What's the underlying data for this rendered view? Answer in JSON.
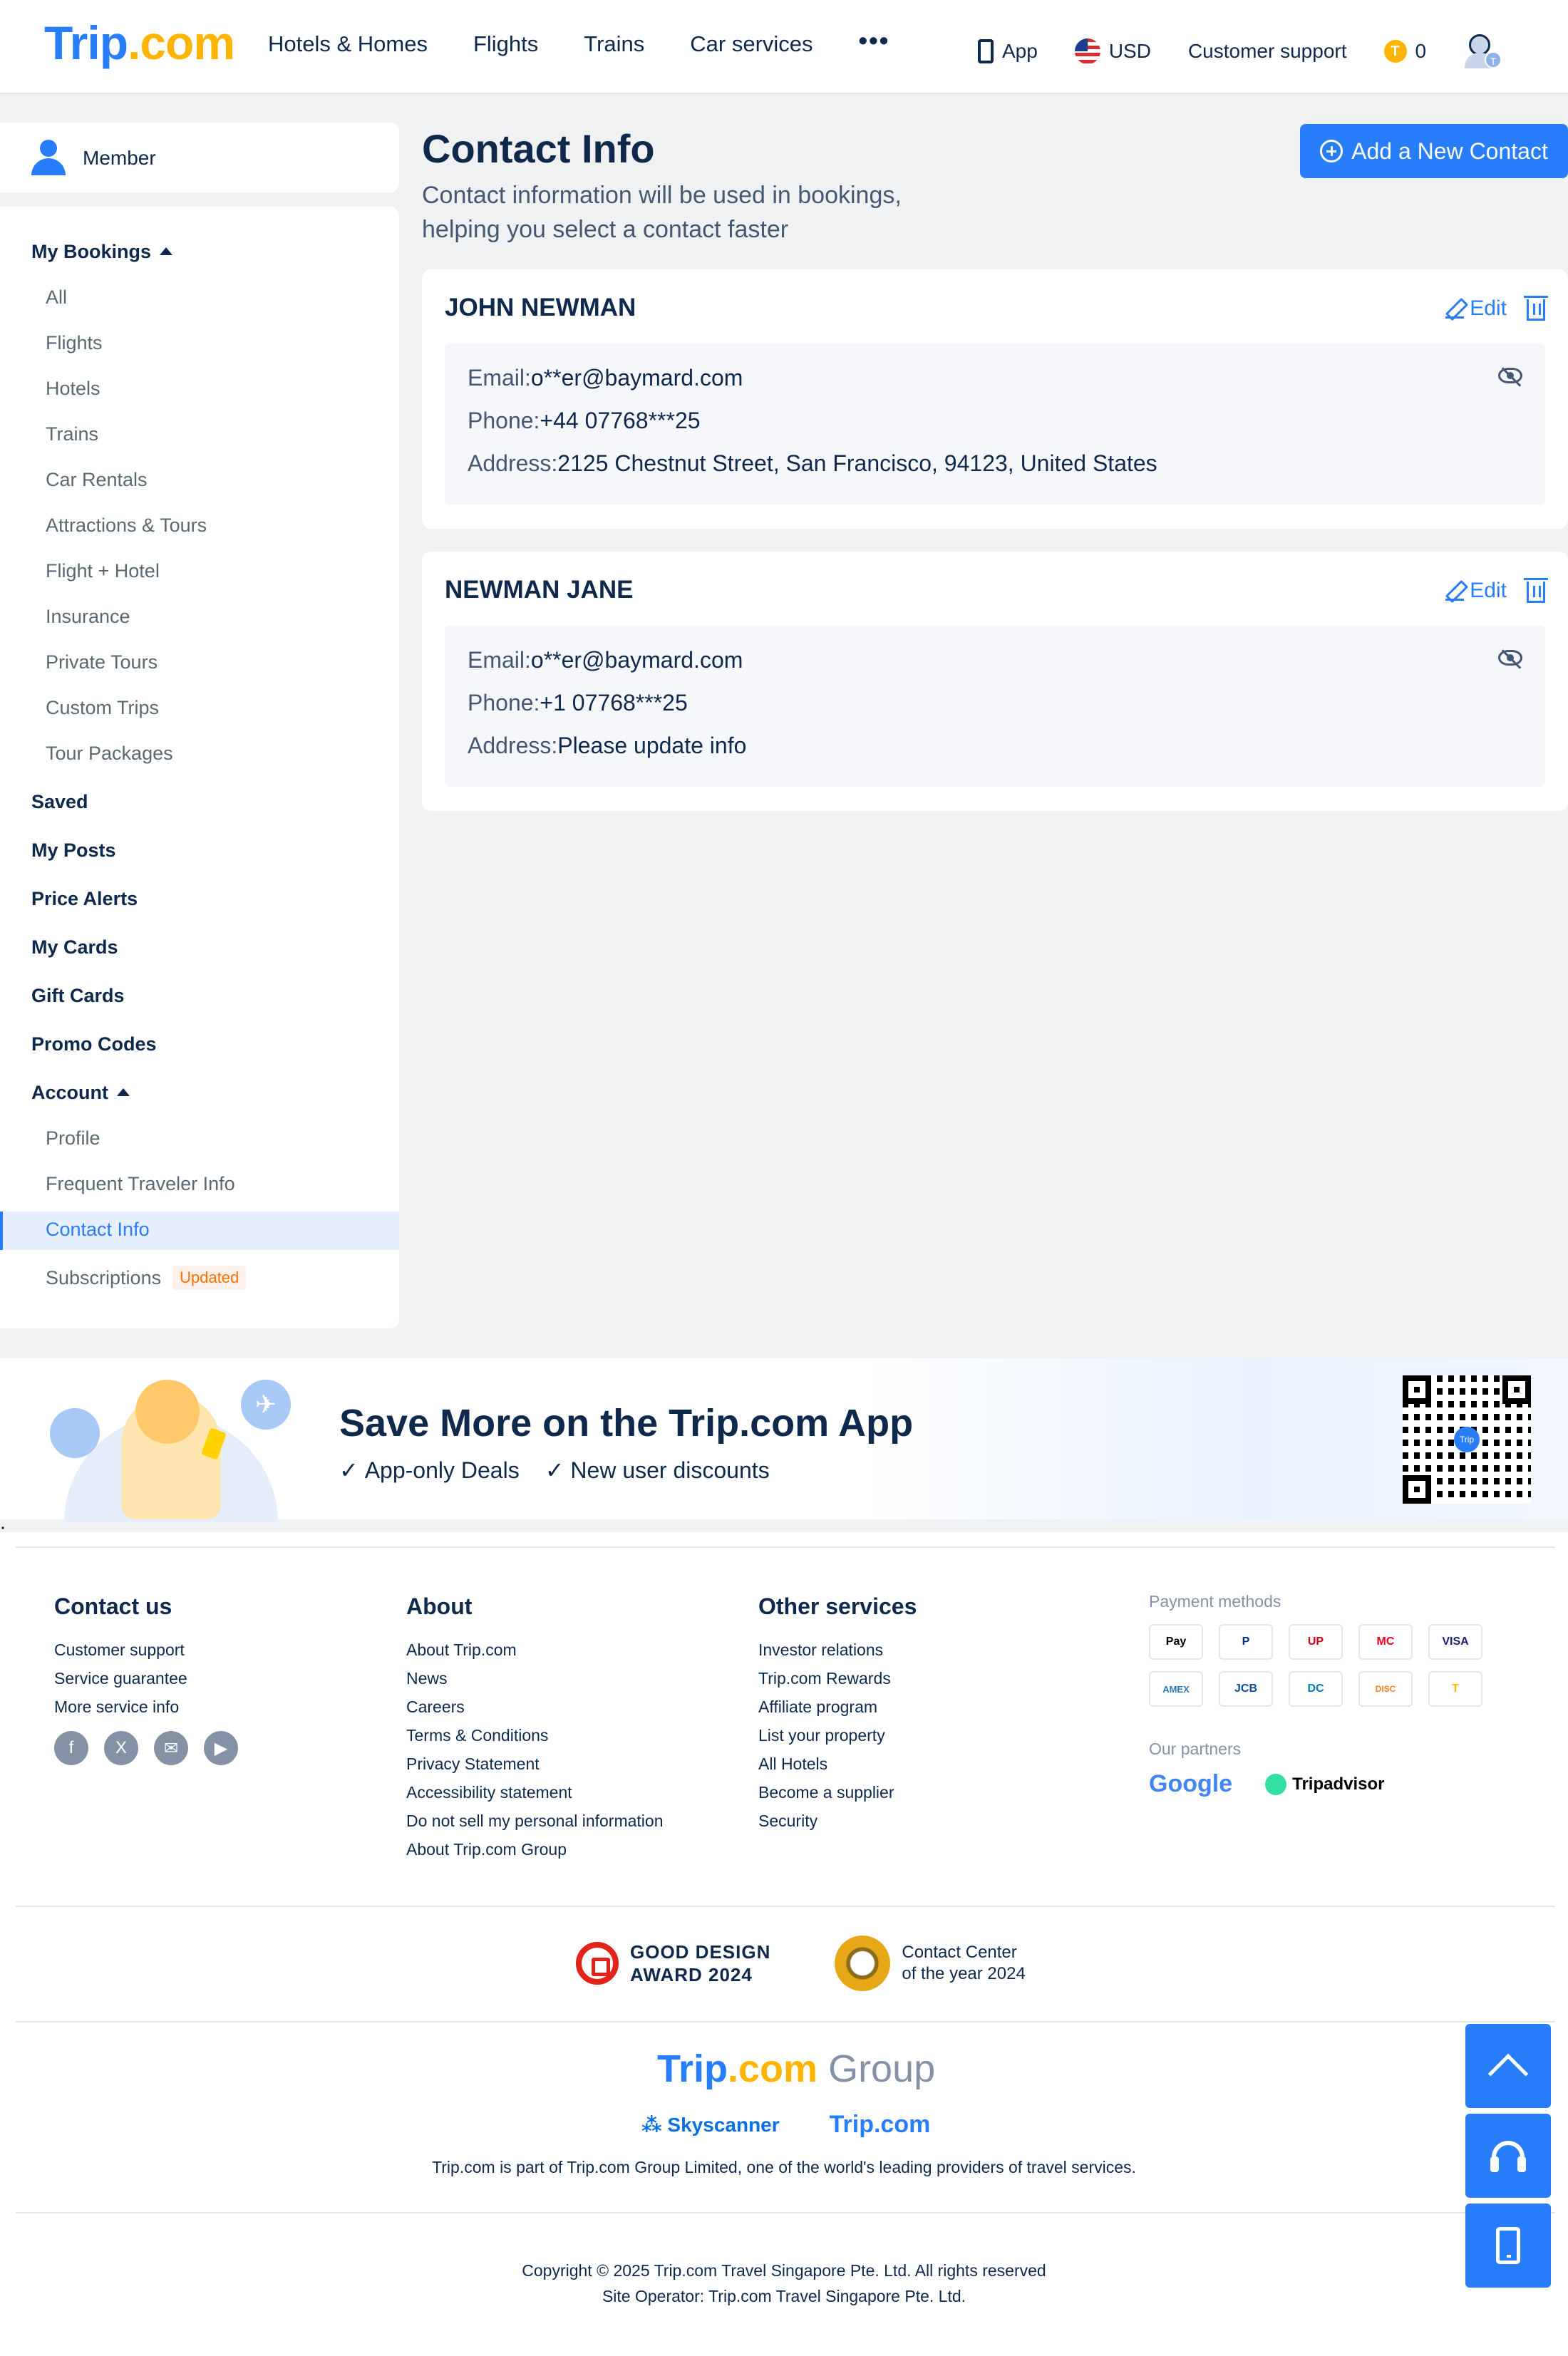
{
  "header": {
    "logo_main": "Trip",
    "logo_dot": ".com",
    "nav": [
      "Hotels & Homes",
      "Flights",
      "Trains",
      "Car services"
    ],
    "more": "•••",
    "app_label": "App",
    "currency": "USD",
    "support": "Customer support",
    "coin_symbol": "T",
    "coins": "0",
    "avatar_badge": "T"
  },
  "sidebar": {
    "member_label": "Member",
    "my_bookings": "My Bookings",
    "bookings": [
      "All",
      "Flights",
      "Hotels",
      "Trains",
      "Car Rentals",
      "Attractions & Tours",
      "Flight + Hotel",
      "Insurance",
      "Private Tours",
      "Custom Trips",
      "Tour Packages"
    ],
    "sections": [
      "Saved",
      "My Posts",
      "Price Alerts",
      "My Cards",
      "Gift Cards",
      "Promo Codes"
    ],
    "account": "Account",
    "account_items": [
      "Profile",
      "Frequent Traveler Info",
      "Contact Info",
      "Subscriptions"
    ],
    "updated_badge": "Updated"
  },
  "main": {
    "title": "Contact Info",
    "subtitle": "Contact information will be used in bookings, helping you select a contact faster",
    "add_button": "Add a New Contact",
    "edit_label": "Edit",
    "contacts": [
      {
        "name": "JOHN NEWMAN",
        "email_key": "Email:",
        "email": "o**er@baymard.com",
        "phone_key": "Phone:",
        "phone": "+44 07768***25",
        "address_key": "Address:",
        "address": "2125 Chestnut Street, San Francisco, 94123, United States"
      },
      {
        "name": "NEWMAN JANE",
        "email_key": "Email:",
        "email": "o**er@baymard.com",
        "phone_key": "Phone:",
        "phone": "+1 07768***25",
        "address_key": "Address:",
        "address": "Please update info"
      }
    ]
  },
  "banner": {
    "title": "Save More on the Trip.com App",
    "features": [
      "App-only Deals",
      "New user discounts"
    ],
    "qr_label": "Trip"
  },
  "stray_text": ";",
  "footer": {
    "contact_title": "Contact us",
    "contact_links": [
      "Customer support",
      "Service guarantee",
      "More service info"
    ],
    "social": [
      "f",
      "X",
      "✉",
      "▶"
    ],
    "about_title": "About",
    "about_links": [
      "About Trip.com",
      "News",
      "Careers",
      "Terms & Conditions",
      "Privacy Statement",
      "Accessibility statement",
      "Do not sell my personal information",
      "About Trip.com Group"
    ],
    "other_title": "Other services",
    "other_links": [
      "Investor relations",
      "Trip.com Rewards",
      "Affiliate program",
      "List your property",
      "All Hotels",
      "Become a supplier",
      "Security"
    ],
    "payment_label": "Payment methods",
    "payments": [
      "Pay",
      "P",
      "UP",
      "MC",
      "VISA",
      "AMEX",
      "JCB",
      "DC",
      "DISC",
      "T"
    ],
    "partners_label": "Our partners",
    "partners": [
      "Google",
      "Tripadvisor"
    ],
    "award1_line1": "GOOD DESIGN",
    "award1_line2": "AWARD 2024",
    "award2_line1": "Contact Center",
    "award2_line2": "of the year 2024",
    "group_main": "Trip",
    "group_dot": ".com",
    "group_word": " Group",
    "skyscanner": "Skyscanner",
    "tripcom": "Trip.com",
    "group_desc": "Trip.com is part of Trip.com Group Limited, one of the world's leading providers of travel services.",
    "copyright1": "Copyright © 2025 Trip.com Travel Singapore Pte. Ltd. All rights reserved",
    "copyright2": "Site Operator: Trip.com Travel Singapore Pte. Ltd."
  }
}
